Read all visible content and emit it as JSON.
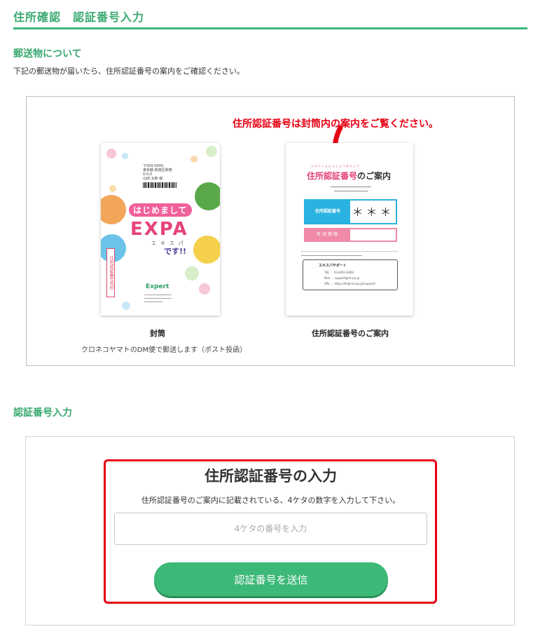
{
  "header": {
    "title": "住所確認　認証番号入力"
  },
  "mail_section": {
    "heading": "郵送物について",
    "intro": "下記の郵送物が届いたら、住所認証番号の案内をご確認ください。",
    "callout": "住所認証番号は封筒内の案内をご覧ください。",
    "envelope": {
      "caption": "封筒",
      "subcaption": "クロネコヤマトのDM便で郵送します（ポスト投函）",
      "ribbon_text": "住所認証番号同封",
      "hello_text": "はじめまして",
      "logo_text": "EXPA",
      "logo_reading": "エキスパ",
      "tagline": "です!!",
      "brand": "Expert"
    },
    "notice": {
      "caption": "住所認証番号のご案内",
      "title_part1": "住所認証番号",
      "title_part2": "のご案内",
      "ruby": "じゅうしょにんしょうばんごう",
      "code_label": "住所認証番号",
      "code_value": "＊＊＊＊",
      "expiry_label": "有効期限",
      "support_title": "エキスパサポート",
      "support_tel": "TEL ： 03-0201-6464",
      "support_mail": "Mail ： support@ex-pa.jp",
      "support_url": "URL ： https://help-ex-pa.jp/support/"
    }
  },
  "code_section": {
    "heading": "認証番号入力",
    "title": "住所認証番号の入力",
    "description": "住所認証番号のご案内に記載されている、4ケタの数字を入力して下さい。",
    "input_placeholder": "4ケタの番号を入力",
    "input_value": "",
    "submit_label": "認証番号を送信"
  },
  "colors": {
    "accent_green": "#3cb878",
    "highlight_red": "#e60012",
    "code_blue": "#2ab3e0",
    "expiry_pink": "#f08aa8"
  }
}
